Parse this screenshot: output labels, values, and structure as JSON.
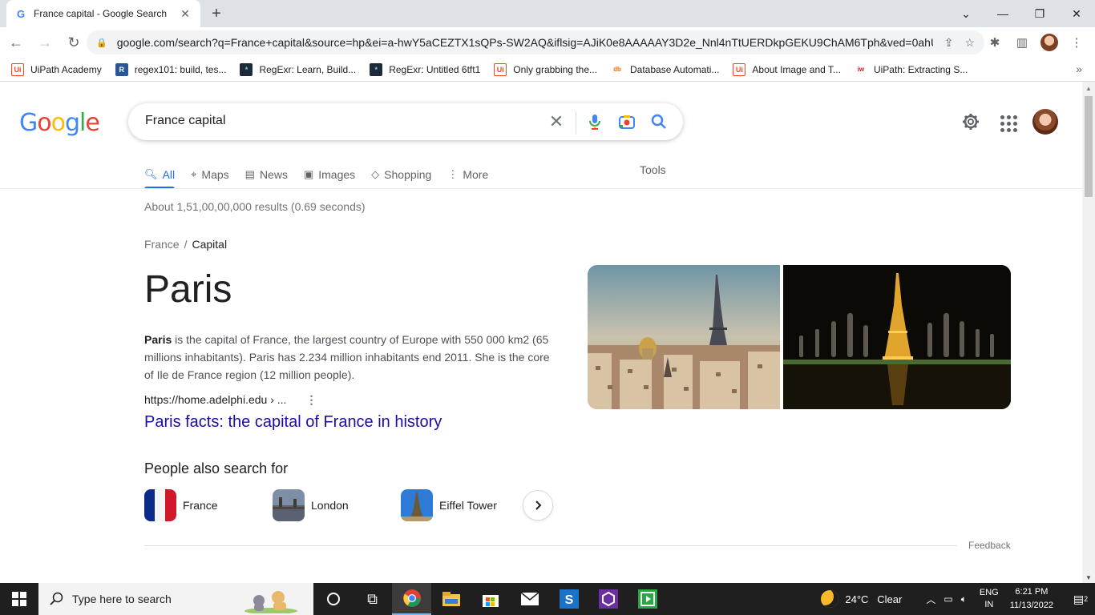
{
  "browser": {
    "tab_title": "France capital - Google Search",
    "tab_favicon": "G",
    "url": "google.com/search?q=France+capital&source=hp&ei=a-hwY5aCEZTX1sQPs-SW2AQ&iflsig=AJiK0e8AAAAAY3D2e_Nnl4nTtUERDkpGEKU9ChAM6Tph&ved=0ahU..."
  },
  "bookmarks": [
    {
      "label": "UiPath Academy",
      "icon": "Ui"
    },
    {
      "label": "regex101: build, tes...",
      "icon": "R"
    },
    {
      "label": "RegExr: Learn, Build...",
      "icon": "*"
    },
    {
      "label": "RegExr: Untitled 6tft1",
      "icon": "*"
    },
    {
      "label": "Only grabbing the...",
      "icon": "Ui"
    },
    {
      "label": "Database Automati...",
      "icon": "db"
    },
    {
      "label": "About Image and T...",
      "icon": "Ui"
    },
    {
      "label": "UiPath: Extracting S...",
      "icon": "iw"
    }
  ],
  "search": {
    "query": "France capital"
  },
  "nav_tabs": [
    {
      "label": "All",
      "icon": "search-icon",
      "active": true
    },
    {
      "label": "Maps",
      "icon": "map-pin-icon"
    },
    {
      "label": "News",
      "icon": "news-icon"
    },
    {
      "label": "Images",
      "icon": "image-icon"
    },
    {
      "label": "Shopping",
      "icon": "tag-icon"
    },
    {
      "label": "More",
      "icon": "more-vert-icon"
    }
  ],
  "tools_label": "Tools",
  "results_stats": "About 1,51,00,00,000 results (0.69 seconds)",
  "breadcrumb": {
    "parent": "France",
    "sep": "/",
    "current": "Capital"
  },
  "answer": "Paris",
  "snippet": {
    "bold": "Paris",
    "text": " is the capital of France, the largest country of Europe with 550 000 km2 (65 millions inhabitants). Paris has 2.234 million inhabitants end 2011. She is the core of Ile de France region (12 million people)."
  },
  "source": {
    "cite": "https://home.adelphi.edu › ...",
    "title": "Paris facts: the capital of France in history"
  },
  "people_also_search": {
    "title": "People also search for",
    "items": [
      "France",
      "London",
      "Eiffel Tower"
    ]
  },
  "feedback": "Feedback",
  "taskbar": {
    "search_placeholder": "Type here to search",
    "temp": "24°C",
    "condition": "Clear",
    "lang_top": "ENG",
    "lang_bottom": "IN",
    "time": "6:21 PM",
    "date": "11/13/2022",
    "notifications": "2"
  },
  "colors": {
    "link": "#1a0dab",
    "accent": "#1a73e8",
    "google_blue": "#4285f4",
    "google_red": "#ea4335",
    "google_yellow": "#fbbc05",
    "google_green": "#34a853"
  }
}
